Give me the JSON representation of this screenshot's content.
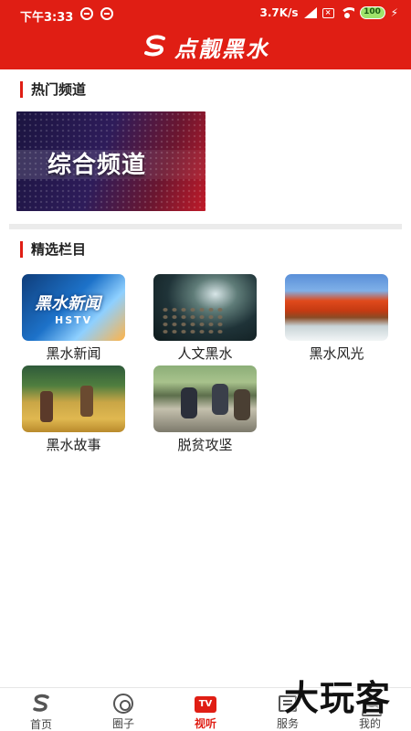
{
  "status_bar": {
    "time": "下午3:33",
    "network_speed": "3.7K/s",
    "battery": "100"
  },
  "header": {
    "app_title": "点靓黑水",
    "logo_icon": "s-swirl-logo-icon"
  },
  "hot_channels": {
    "section_title": "热门频道",
    "banner_text": "综合频道"
  },
  "featured": {
    "section_title": "精选栏目",
    "items": [
      {
        "label": "黑水新闻",
        "thumb_logo": "黑水新闻",
        "thumb_sub": "HSTV"
      },
      {
        "label": "人文黑水"
      },
      {
        "label": "黑水风光"
      },
      {
        "label": "黑水故事"
      },
      {
        "label": "脱贫攻坚"
      }
    ]
  },
  "bottom_nav": {
    "items": [
      {
        "label": "首页",
        "icon": "home-logo-icon"
      },
      {
        "label": "圈子",
        "icon": "disc-icon"
      },
      {
        "label": "视听",
        "icon": "tv-icon",
        "icon_text": "TV",
        "active": true
      },
      {
        "label": "服务",
        "icon": "service-icon"
      },
      {
        "label": "我的",
        "icon": "person-icon"
      }
    ]
  },
  "watermark": "大玩客",
  "colors": {
    "brand_red": "#e01e14",
    "divider_gray": "#ebebeb"
  }
}
